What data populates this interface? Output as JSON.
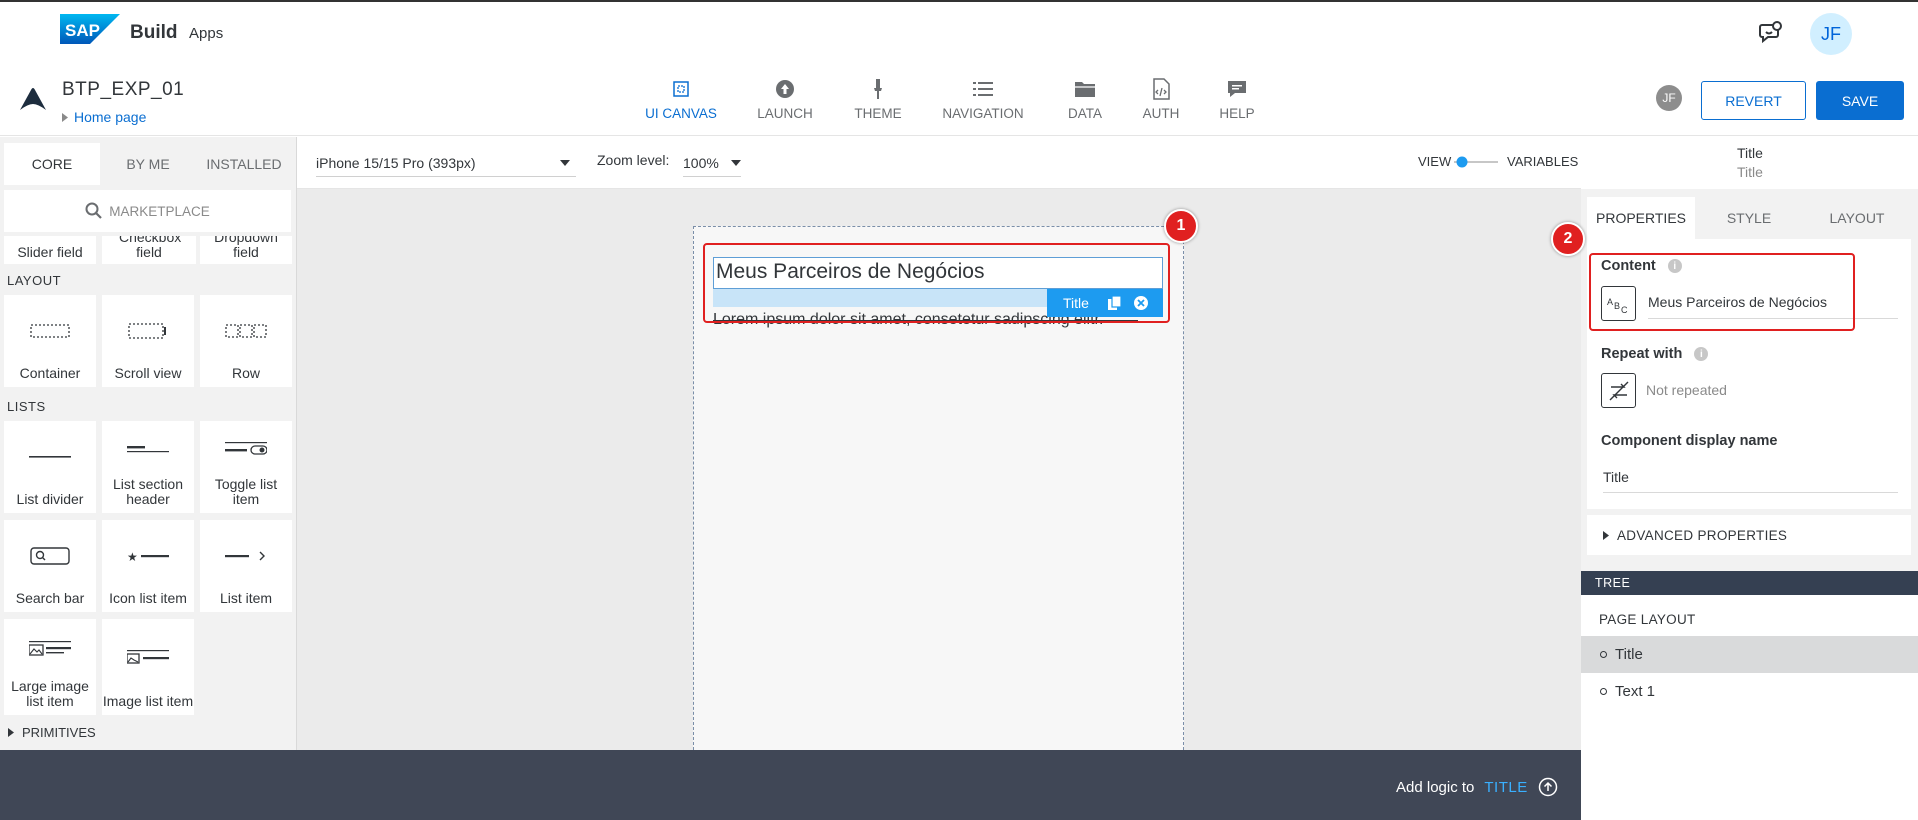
{
  "shell": {
    "logo_text": "SAP",
    "brand": "Build",
    "product": "Apps",
    "user_initials": "JF"
  },
  "project": {
    "name": "BTP_EXP_01",
    "page": "Home page"
  },
  "nav": [
    {
      "label": "UI CANVAS",
      "icon": "ui-canvas-icon",
      "active": true
    },
    {
      "label": "LAUNCH",
      "icon": "launch-icon"
    },
    {
      "label": "THEME",
      "icon": "theme-icon"
    },
    {
      "label": "NAVIGATION",
      "icon": "navigation-icon"
    },
    {
      "label": "DATA",
      "icon": "data-icon"
    },
    {
      "label": "AUTH",
      "icon": "auth-icon"
    },
    {
      "label": "HELP",
      "icon": "help-icon"
    }
  ],
  "actions": {
    "collaborator_initials": "JF",
    "revert": "REVERT",
    "save": "SAVE"
  },
  "left_panel": {
    "tabs": [
      "CORE",
      "BY ME",
      "INSTALLED"
    ],
    "marketplace": "MARKETPLACE",
    "partial_tiles": [
      "Slider field",
      "Checkbox field",
      "Dropdown field"
    ],
    "sections": {
      "layout": "LAYOUT",
      "lists": "LISTS",
      "primitives": "PRIMITIVES"
    },
    "layout_tiles": [
      "Container",
      "Scroll view",
      "Row"
    ],
    "list_tiles": [
      "List divider",
      "List section header",
      "Toggle list item",
      "Search bar",
      "Icon list item",
      "List item",
      "Large image list item",
      "Image list item"
    ]
  },
  "canvas_toolbar": {
    "device": "iPhone 15/15 Pro (393px)",
    "zoom_label": "Zoom level:",
    "zoom": "100%",
    "view": "VIEW",
    "variables": "VARIABLES"
  },
  "canvas": {
    "title_text": "Meus Parceiros de Negócios",
    "body_text": "Lorem ipsum dolor sit amet, consetetur sadipscing elitr.",
    "selection_label": "Title",
    "annotation_1": "1",
    "annotation_2": "2"
  },
  "bottom_bar": {
    "prefix": "Add logic to",
    "target": "TITLE"
  },
  "right_panel": {
    "component_title": "Title",
    "component_subtitle": "Title",
    "tabs": [
      "PROPERTIES",
      "STYLE",
      "LAYOUT"
    ],
    "content_label": "Content",
    "content_value": "Meus Parceiros de Negócios",
    "repeat_label": "Repeat with",
    "repeat_value": "Not repeated",
    "display_name_label": "Component display name",
    "display_name_value": "Title",
    "advanced": "ADVANCED PROPERTIES",
    "tree_header": "TREE",
    "page_layout": "PAGE LAYOUT",
    "tree_items": [
      "Title",
      "Text 1"
    ]
  },
  "colors": {
    "accent": "#0a6ed1",
    "annotation": "#e02020",
    "bottom_bar": "#404756"
  }
}
